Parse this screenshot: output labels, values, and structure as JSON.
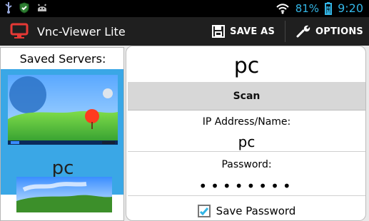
{
  "status": {
    "battery_percent": "81%",
    "time": "9:20"
  },
  "app": {
    "title": "Vnc-Viewer Lite"
  },
  "actions": {
    "save_as": "SAVE AS",
    "options": "OPTIONS"
  },
  "servers": {
    "heading": "Saved Servers:",
    "items": [
      {
        "name": "pc"
      }
    ]
  },
  "details": {
    "title": "pc",
    "scan_label": "Scan",
    "ip_label": "IP Address/Name:",
    "ip_value": "pc",
    "password_label": "Password:",
    "password_value": "••••••••",
    "save_password_label": "Save Password"
  },
  "colors": {
    "accent": "#33b5e5",
    "selection": "#3aa7e6",
    "brand_red": "#e53935"
  },
  "icons": {
    "usb": "usb-icon",
    "shield": "shield-icon",
    "android": "android-icon",
    "wifi": "wifi-icon",
    "battery": "battery-icon",
    "app": "monitor-icon",
    "save": "floppy-icon",
    "options": "wrench-icon",
    "checkbox": "checkbox-icon"
  }
}
